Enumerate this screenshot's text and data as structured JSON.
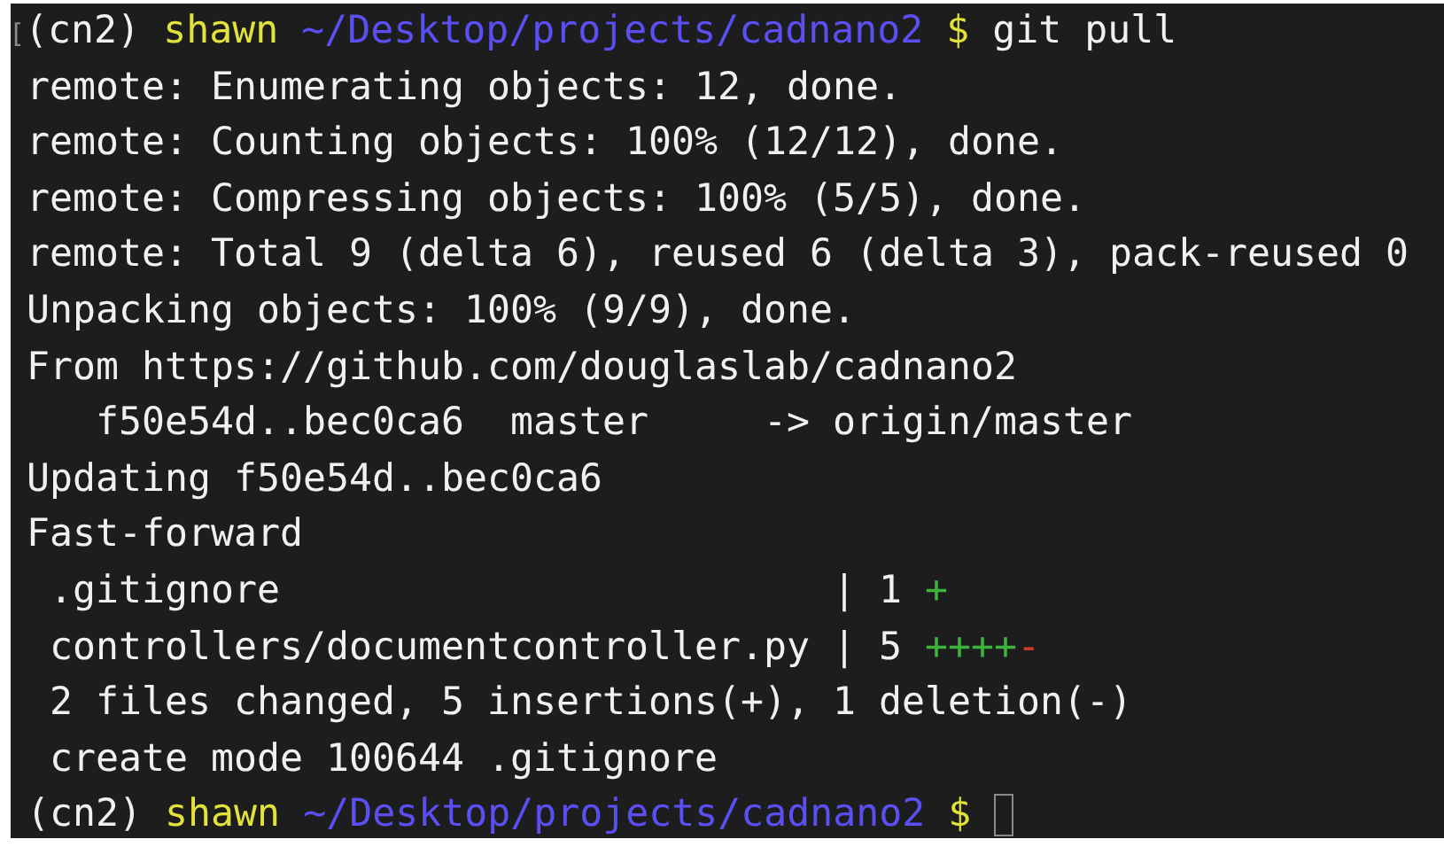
{
  "terminal": {
    "lines": [
      {
        "segments": [
          {
            "kind": "marker",
            "text": "["
          },
          {
            "kind": "env",
            "text": "(cn2)"
          },
          {
            "kind": "user",
            "text": "shawn"
          },
          {
            "kind": "path",
            "text": "~/Desktop/projects/cadnano2"
          },
          {
            "kind": "symbol",
            "text": "$"
          },
          {
            "kind": "command",
            "text": "git pull"
          }
        ]
      },
      {
        "segments": [
          {
            "kind": "output",
            "text": "remote: Enumerating objects: 12, done."
          }
        ]
      },
      {
        "segments": [
          {
            "kind": "output",
            "text": "remote: Counting objects: 100% (12/12), done."
          }
        ]
      },
      {
        "segments": [
          {
            "kind": "output",
            "text": "remote: Compressing objects: 100% (5/5), done."
          }
        ]
      },
      {
        "segments": [
          {
            "kind": "output",
            "text": "remote: Total 9 (delta 6), reused 6 (delta 3), pack-reused 0"
          }
        ]
      },
      {
        "segments": [
          {
            "kind": "output",
            "text": "Unpacking objects: 100% (9/9), done."
          }
        ]
      },
      {
        "segments": [
          {
            "kind": "output",
            "text": "From https://github.com/douglaslab/cadnano2"
          }
        ]
      },
      {
        "segments": [
          {
            "kind": "output",
            "text": "   f50e54d..bec0ca6  master     -> origin/master"
          }
        ]
      },
      {
        "segments": [
          {
            "kind": "output",
            "text": "Updating f50e54d..bec0ca6"
          }
        ]
      },
      {
        "segments": [
          {
            "kind": "output",
            "text": "Fast-forward"
          }
        ]
      },
      {
        "segments": [
          {
            "kind": "output",
            "text": " .gitignore                        | 1"
          },
          {
            "kind": "added",
            "text": "+"
          }
        ]
      },
      {
        "segments": [
          {
            "kind": "output",
            "text": " controllers/documentcontroller.py | 5"
          },
          {
            "kind": "added",
            "text": "++++"
          },
          {
            "kind": "removed",
            "text": "-"
          }
        ]
      },
      {
        "segments": [
          {
            "kind": "output",
            "text": " 2 files changed, 5 insertions(+), 1 deletion(-)"
          }
        ]
      },
      {
        "segments": [
          {
            "kind": "output",
            "text": " create mode 100644 .gitignore"
          }
        ]
      },
      {
        "segments": [
          {
            "kind": "env",
            "text": "(cn2)"
          },
          {
            "kind": "user",
            "text": "shawn"
          },
          {
            "kind": "path",
            "text": "~/Desktop/projects/cadnano2"
          },
          {
            "kind": "symbol",
            "text": "$"
          },
          {
            "kind": "cursor"
          }
        ]
      }
    ]
  }
}
